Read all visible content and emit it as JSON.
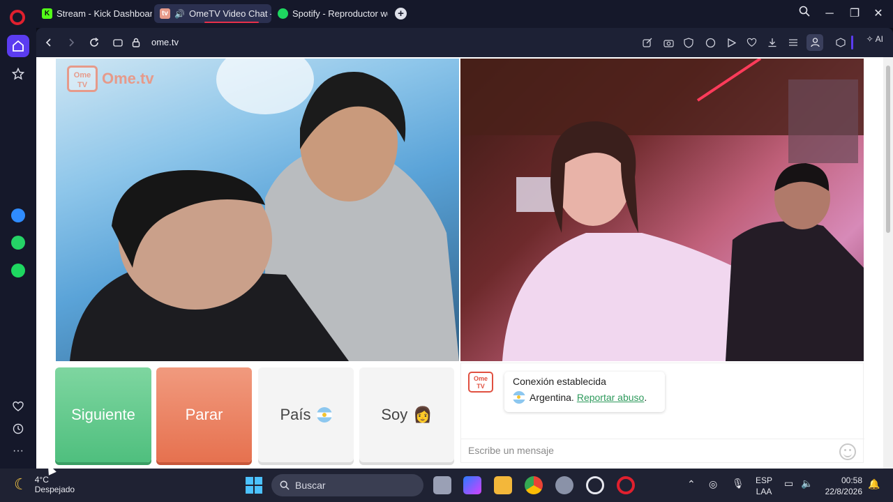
{
  "browser": {
    "tabs": [
      {
        "label": "Stream - Kick Dashboard",
        "icon": "kick-icon",
        "active": false
      },
      {
        "label": "OmeTV Video Chat —",
        "icon": "ometv-icon",
        "active": true
      },
      {
        "label": "Spotify - Reproductor web",
        "icon": "spotify-icon",
        "active": false
      }
    ],
    "url": "ome.tv",
    "ai_label": "AI"
  },
  "page": {
    "brand": {
      "logo_text": "Ome TV",
      "name": "Ome.tv"
    },
    "buttons": {
      "next": "Siguiente",
      "stop": "Parar",
      "country": "País",
      "gender": "Soy",
      "gender_emoji": "👩"
    },
    "chat": {
      "logo_text": "Ome TV",
      "status": "Conexión establecida",
      "country": "Argentina.",
      "report_link": "Reportar abuso",
      "report_suffix": ".",
      "placeholder": "Escribe un mensaje"
    }
  },
  "taskbar": {
    "weather": {
      "temp": "4°C",
      "condition": "Despejado"
    },
    "search": "Buscar",
    "language": {
      "lang": "ESP",
      "layout": "LAA"
    },
    "time": "00:58",
    "date": "22/8/2026"
  },
  "colors": {
    "next_button": "#5cc98a",
    "stop_button": "#eb825f",
    "report_link": "#2e9a5c",
    "home_active": "#5b3cf0"
  }
}
